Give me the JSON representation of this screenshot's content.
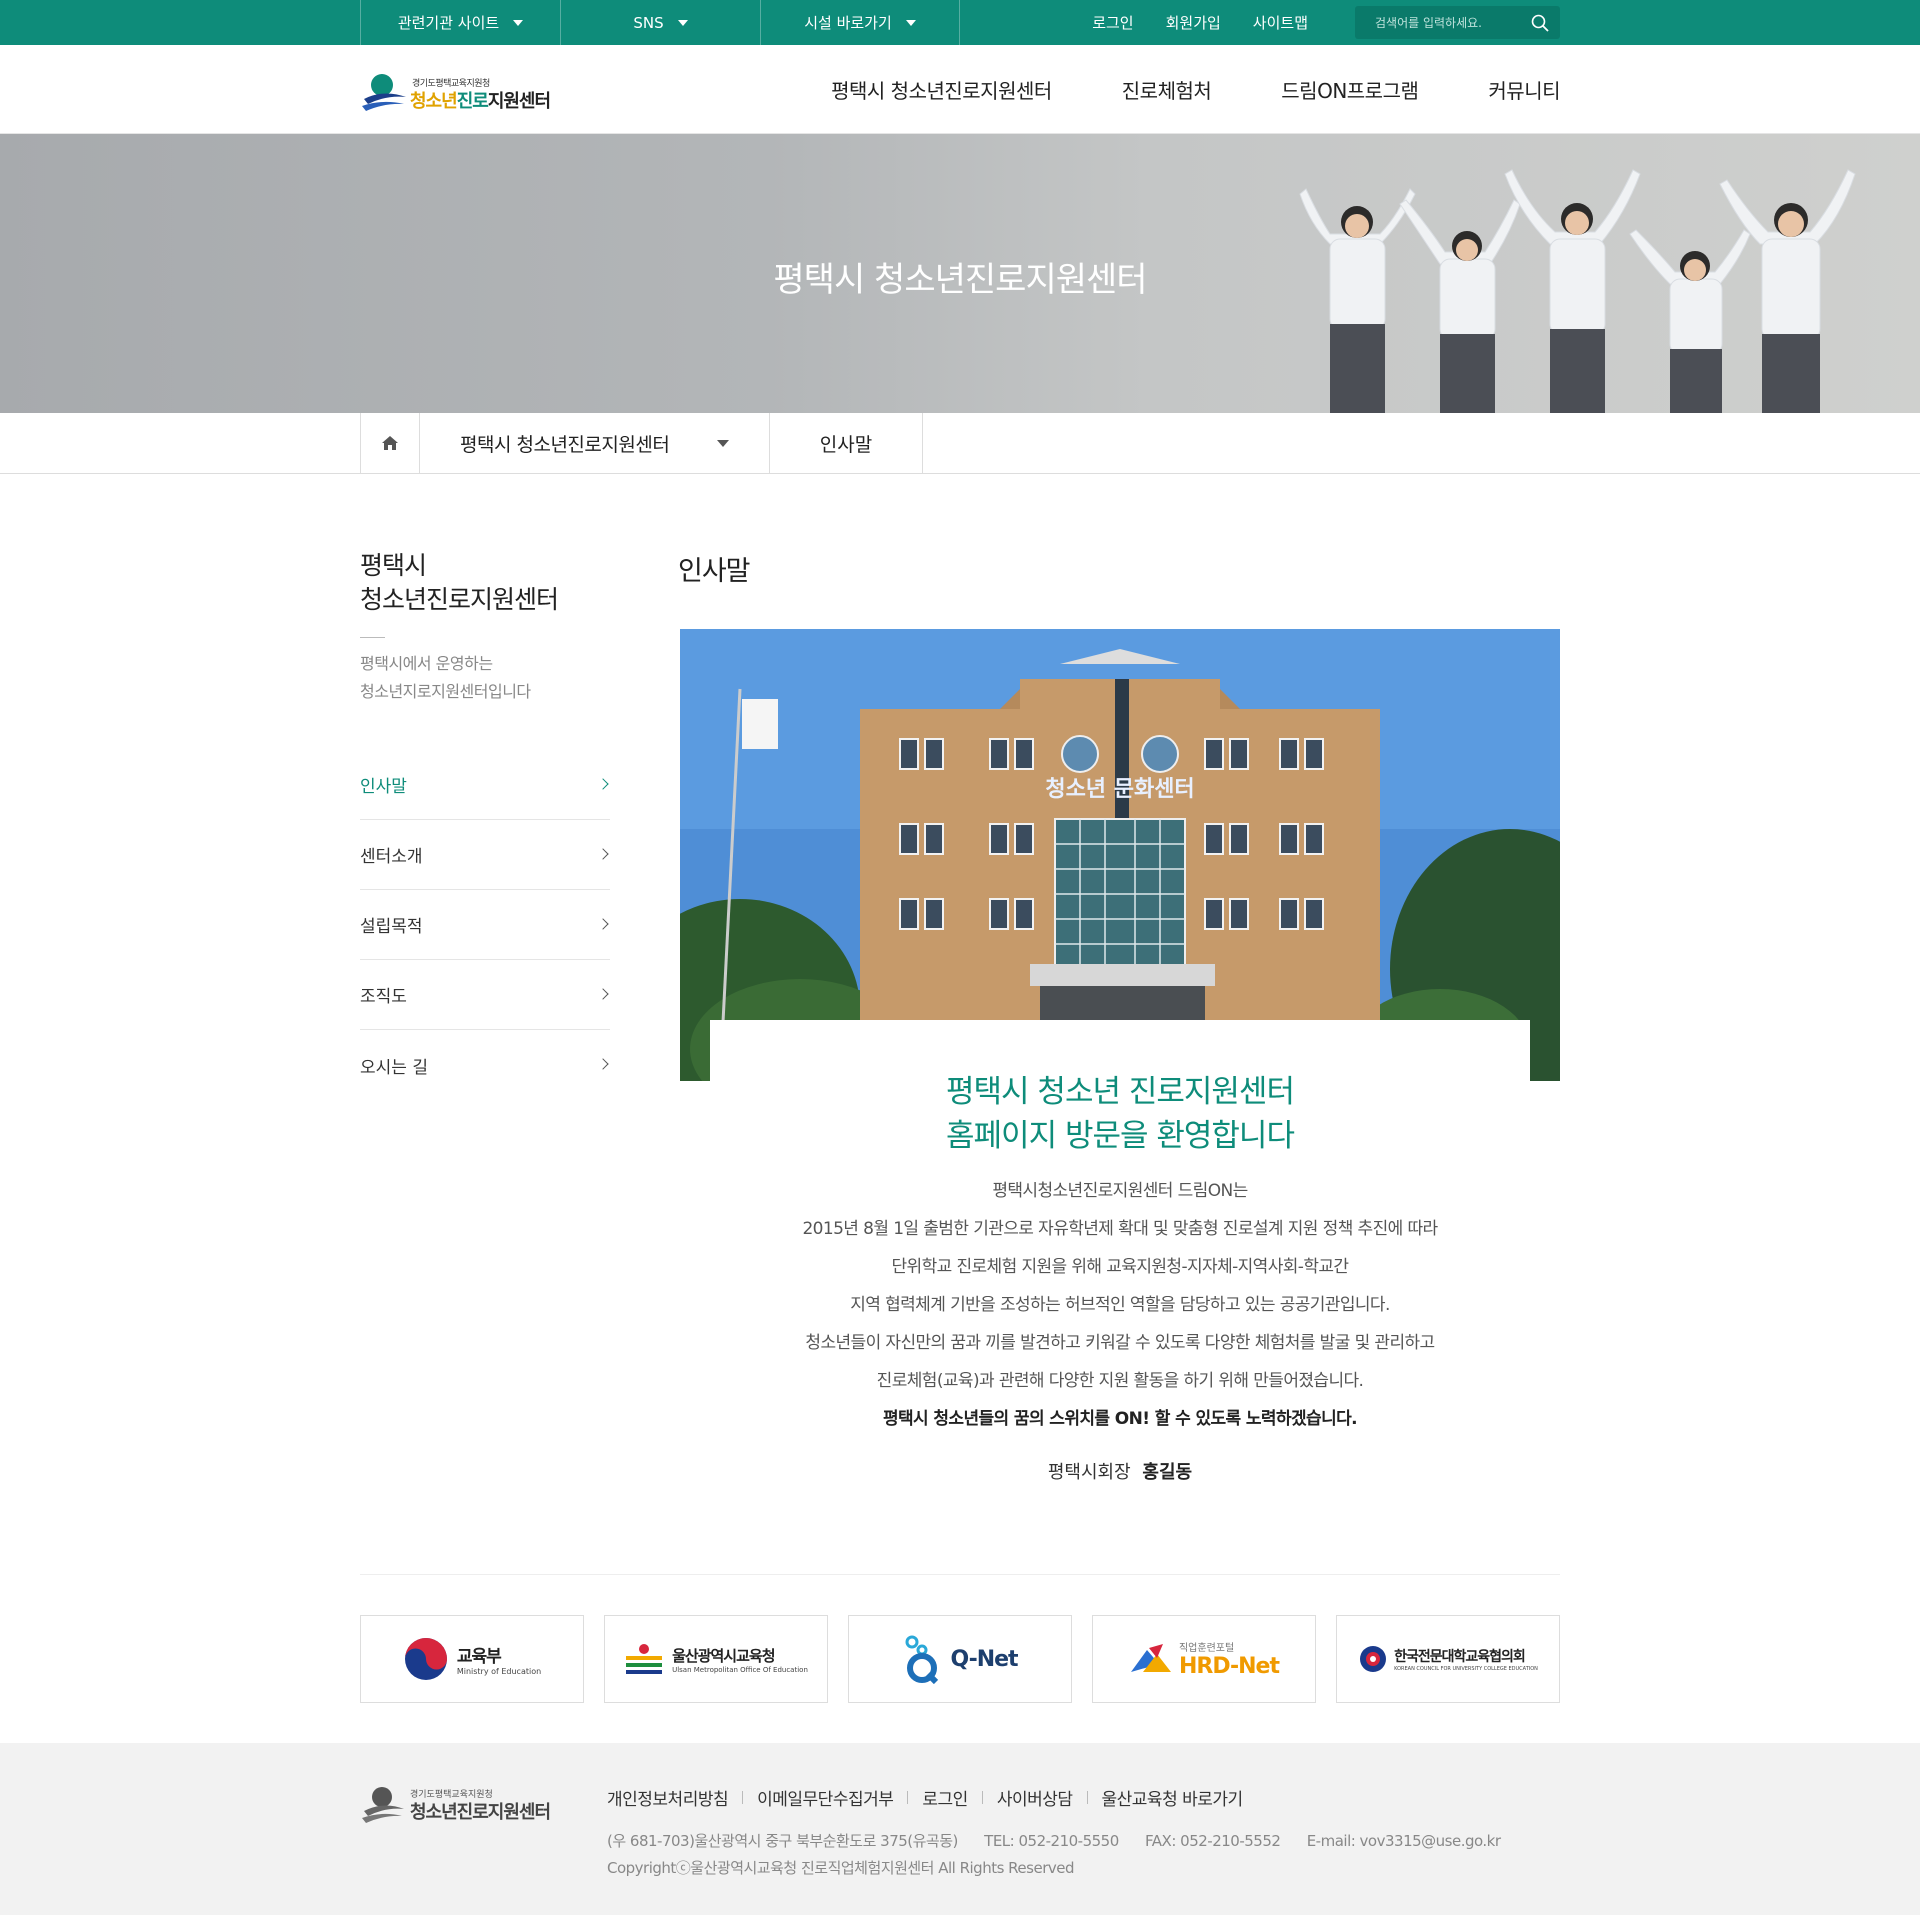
{
  "util": {
    "dropdowns": [
      "관련기관 사이트",
      "SNS",
      "시설 바로가기"
    ],
    "links": [
      "로그인",
      "회원가입",
      "사이트맵"
    ],
    "search_placeholder": "검색어를 입력하세요."
  },
  "logo": {
    "sub": "경기도평택교육지원청",
    "main_part1": "청소년",
    "main_part2": "진로",
    "main_part3": "지원센터"
  },
  "gnb": [
    "평택시 청소년진로지원센터",
    "진로체험처",
    "드림ON프로그램",
    "커뮤니티"
  ],
  "visual": {
    "title": "평택시 청소년진로지원센터"
  },
  "location": {
    "depth1": "평택시 청소년진로지원센터",
    "depth2": "인사말"
  },
  "lnb": {
    "title_line1": "평택시",
    "title_line2": "청소년진로지원센터",
    "desc_line1": "평택시에서 운영하는",
    "desc_line2": "청소년지로지원센터입니다",
    "menu": [
      "인사말",
      "센터소개",
      "설립목적",
      "조직도",
      "오시는 길"
    ]
  },
  "content": {
    "title": "인사말",
    "building_sign": "청소년 문화센터",
    "heading_line1": "평택시 청소년 진로지원센터",
    "heading_line2": "홈페이지 방문을 환영합니다",
    "paragraphs": [
      "평택시청소년진로지원센터 드림ON는",
      "2015년 8월 1일 출범한 기관으로 자유학년제 확대 및 맞춤형 진로설계 지원 정책 추진에 따라",
      "단위학교 진로체험 지원을 위해 교육지원청-지자체-지역사회-학교간",
      "지역 협력체계 기반을 조성하는 허브적인 역할을 담당하고 있는 공공기관입니다.",
      "청소년들이 자신만의 꿈과 끼를 발견하고 키워갈 수 있도록 다양한 체험처를 발굴 및 관리하고",
      "진로체험(교육)과 관련해 다양한 지원 활동을 하기 위해 만들어졌습니다."
    ],
    "emphasis": "평택시 청소년들의 꿈의 스위치를 ON! 할 수 있도록 노력하겠습니다.",
    "sign_role": "평택시회장",
    "sign_name": "홍길동"
  },
  "banners": [
    {
      "name": "교육부",
      "sub": "Ministry of Education"
    },
    {
      "name": "울산광역시교육청",
      "sub": "Ulsan Metropolitan Office Of Education"
    },
    {
      "name": "Q-Net",
      "sub": ""
    },
    {
      "name": "HRD-Net",
      "sub": "직업훈련포털"
    },
    {
      "name": "한국전문대학교육협의회",
      "sub": "KOREAN COUNCIL FOR UNIVERSITY COLLEGE EDUCATION"
    }
  ],
  "footer": {
    "logo_sub": "경기도평택교육지원청",
    "logo_main": "청소년진로지원센터",
    "links": [
      "개인정보처리방침",
      "이메일무단수집거부",
      "로그인",
      "사이버상담",
      "울산교육청 바로가기"
    ],
    "address": "(우 681-703)울산광역시 중구 북부순환도로 375(유곡동)",
    "tel": "TEL: 052-210-5550",
    "fax": "FAX: 052-210-5552",
    "email": "E-mail: vov3315@use.go.kr",
    "copyright": "Copyrightⓒ울산광역시교육청 진로직업체험지원센터 All Rights Reserved"
  },
  "colors": {
    "primary": "#0e8c7a",
    "accent_yellow": "#e0a200"
  }
}
